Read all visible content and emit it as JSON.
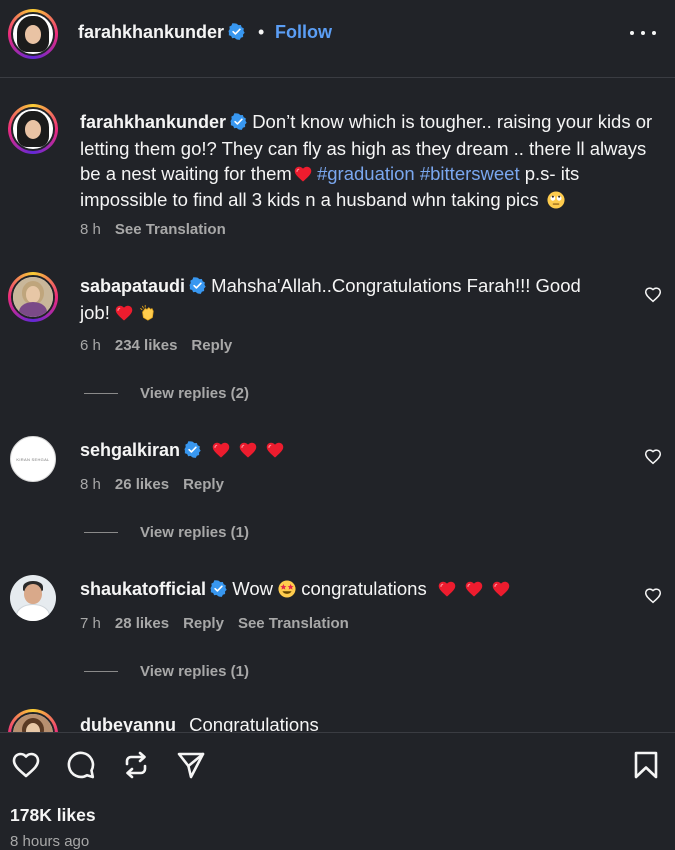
{
  "post": {
    "author": "farahkhankunder",
    "separator": "•",
    "follow_label": "Follow",
    "caption": {
      "username": "farahkhankunder",
      "text_before": "Don’t know which is tougher.. raising your kids or letting them go!? They can fly as high as they dream .. there ll always be a nest waiting for them",
      "hashtag1": "#graduation",
      "hashtag2": "#bittersweet",
      "text_after": "p.s- its impossible to find all 3 kids n a husband whn taking pics",
      "time": "8 h",
      "translate": "See Translation"
    }
  },
  "comments": [
    {
      "username": "sabapataudi",
      "text": "Mahsha'Allah..Congratulations Farah!!! Good job!",
      "time": "6 h",
      "likes": "234 likes",
      "reply": "Reply",
      "view_replies": "View replies (2)"
    },
    {
      "username": "sehgalkiran",
      "logo_text": "KIRAN SEHGAL",
      "time": "8 h",
      "likes": "26 likes",
      "reply": "Reply",
      "view_replies": "View replies (1)"
    },
    {
      "username": "shaukatofficial",
      "text_before": "Wow",
      "text_after": "congratulations",
      "time": "7 h",
      "likes": "28 likes",
      "reply": "Reply",
      "translate": "See Translation",
      "view_replies": "View replies (1)"
    },
    {
      "username": "dubeyannu",
      "text": "Congratulations"
    }
  ],
  "footer": {
    "likes": "178K likes",
    "time_ago": "8 hours ago"
  },
  "colors": {
    "background": "#212328",
    "link": "#5b9ef5",
    "hashtag": "#7aa7ef",
    "verified": "#3897f0",
    "heart": "#ed1c2e"
  },
  "icons": [
    "verified-badge-icon",
    "more-options-icon",
    "heart-icon",
    "comment-icon",
    "share-icon",
    "send-icon",
    "save-icon",
    "heart-emoji-icon",
    "clap-emoji-icon",
    "star-struck-emoji-icon",
    "eye-roll-emoji-icon"
  ]
}
